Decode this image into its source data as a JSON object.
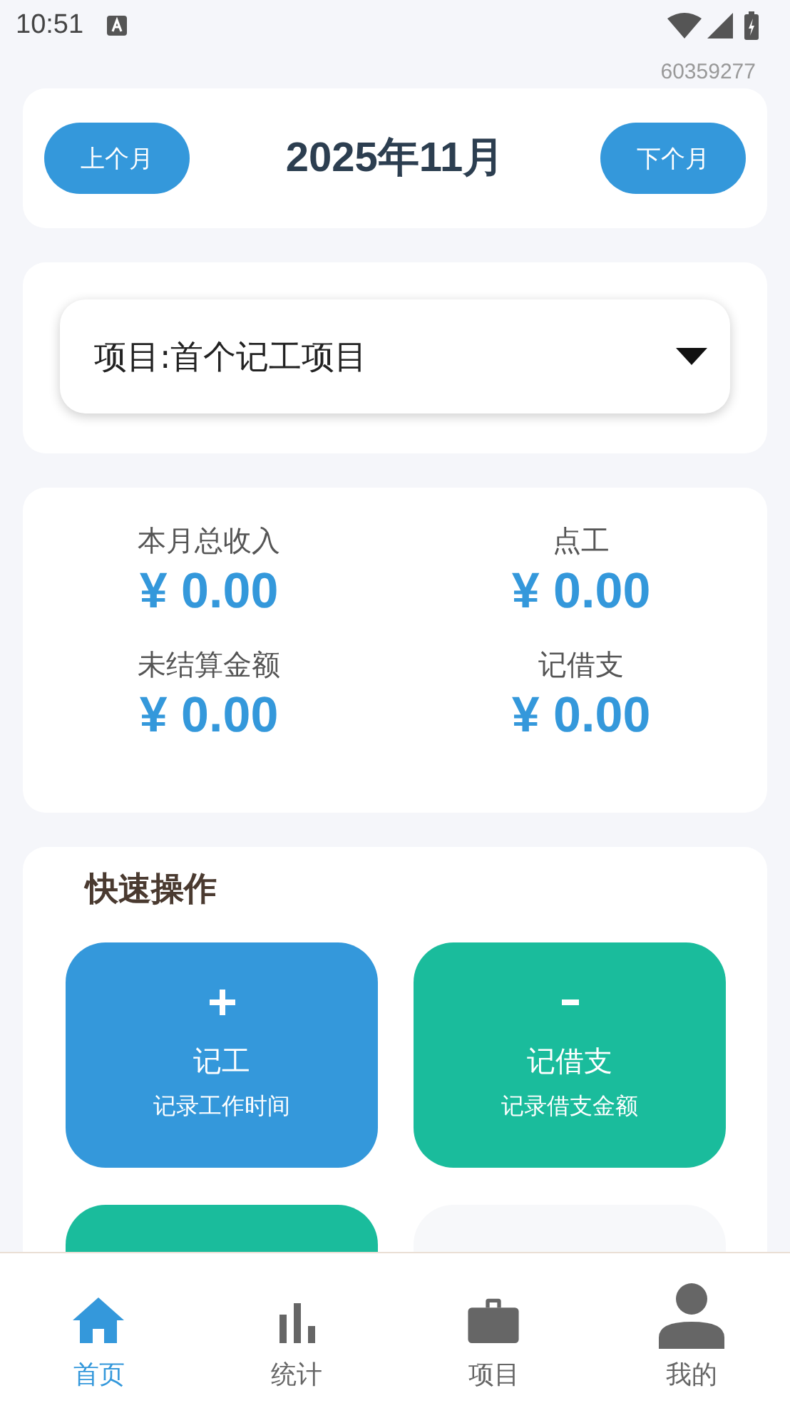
{
  "status_bar": {
    "time": "10:51"
  },
  "user_id": "60359277",
  "month_nav": {
    "prev": "上个月",
    "title": "2025年11月",
    "next": "下个月"
  },
  "project_select": {
    "value": "项目:首个记工项目"
  },
  "summary": [
    {
      "label": "本月总收入",
      "value": "¥ 0.00"
    },
    {
      "label": "点工",
      "value": "¥ 0.00"
    },
    {
      "label": "未结算金额",
      "value": "¥ 0.00"
    },
    {
      "label": "记借支",
      "value": "¥ 0.00"
    }
  ],
  "quick_actions": {
    "title": "快速操作",
    "tiles": [
      {
        "kind": "add",
        "color": "#3498db",
        "label": "记工",
        "sub": "记录工作时间"
      },
      {
        "kind": "minus",
        "color": "#1abc9c",
        "label": "记借支",
        "sub": "记录借支金额"
      },
      {
        "kind": "blank",
        "color": "#1abc9c"
      },
      {
        "kind": "blank",
        "color": "#f7f8fa"
      }
    ]
  },
  "bottom_nav": [
    {
      "label": "首页",
      "kind": "home",
      "selected": true
    },
    {
      "label": "统计",
      "kind": "stats",
      "selected": false
    },
    {
      "label": "项目",
      "kind": "projects",
      "selected": false
    },
    {
      "label": "我的",
      "kind": "profile",
      "selected": false
    }
  ]
}
